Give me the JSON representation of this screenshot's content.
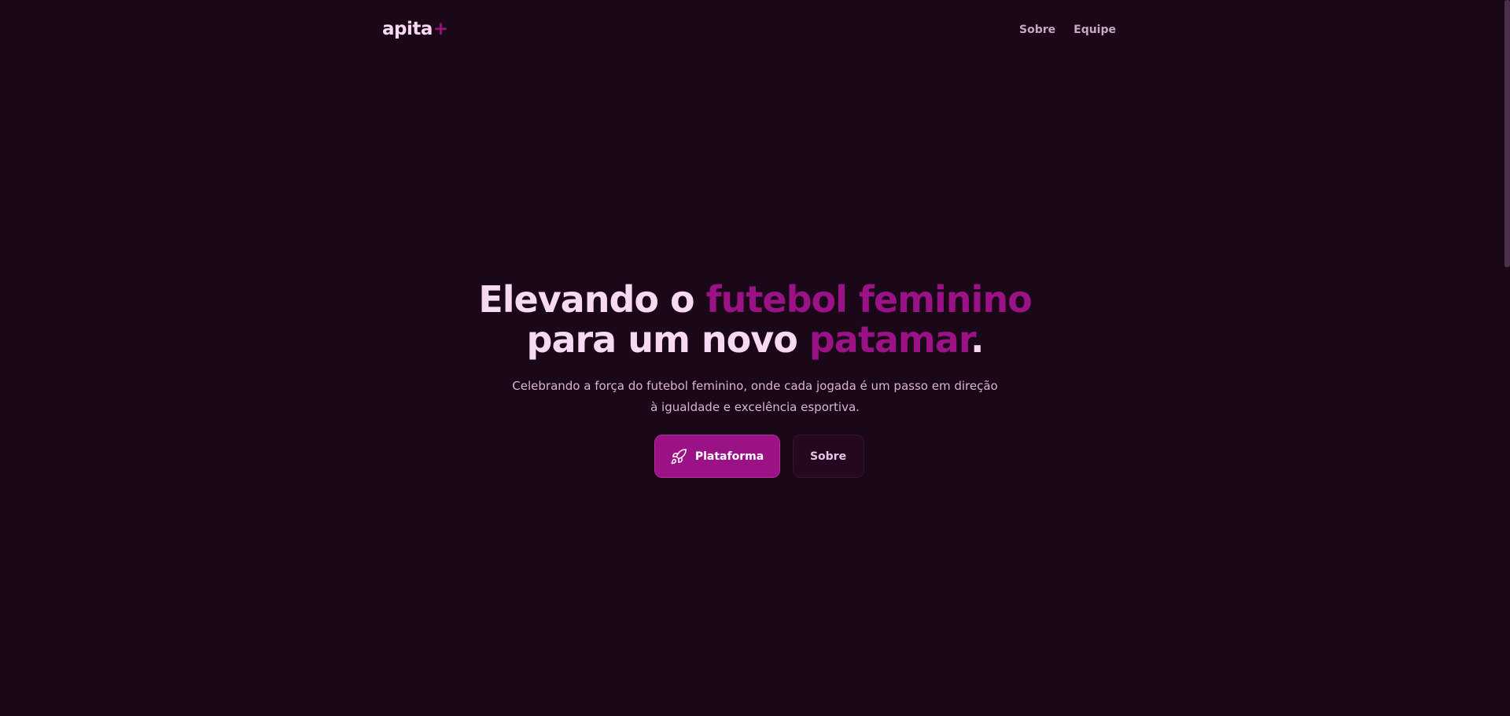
{
  "header": {
    "logo_text": "apita",
    "logo_plus": "+",
    "nav": {
      "about_label": "Sobre",
      "team_label": "Equipe"
    }
  },
  "hero": {
    "headline": {
      "part1": "Elevando o ",
      "accent1": "futebol feminino",
      "part2": "para um novo ",
      "accent2": "patamar",
      "end": "."
    },
    "subtitle_line1": "Celebrando a força do futebol feminino, onde cada jogada é um passo em direção",
    "subtitle_line2": "à igualdade e excelência esportiva.",
    "primary_button": {
      "label": "Plataforma",
      "icon": "rocket-icon"
    },
    "secondary_button": {
      "label": "Sobre"
    }
  },
  "colors": {
    "background": "#1a0818",
    "accent": "#9b1286",
    "text_light": "#f7d9f3",
    "text_muted": "#d9b3d3"
  }
}
